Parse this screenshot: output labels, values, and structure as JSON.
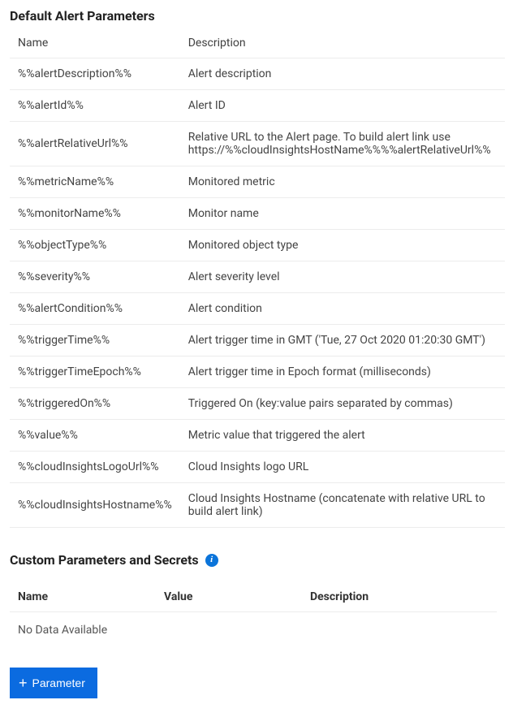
{
  "defaultParams": {
    "title": "Default Alert Parameters",
    "headers": {
      "name": "Name",
      "description": "Description"
    },
    "rows": [
      {
        "name": "%%alertDescription%%",
        "desc": "Alert description"
      },
      {
        "name": "%%alertId%%",
        "desc": "Alert ID"
      },
      {
        "name": "%%alertRelativeUrl%%",
        "desc": "Relative URL to the Alert page. To build alert link use https://%%cloudInsightsHostName%%%%alertRelativeUrl%%"
      },
      {
        "name": "%%metricName%%",
        "desc": "Monitored metric"
      },
      {
        "name": "%%monitorName%%",
        "desc": "Monitor name"
      },
      {
        "name": "%%objectType%%",
        "desc": "Monitored object type"
      },
      {
        "name": "%%severity%%",
        "desc": "Alert severity level"
      },
      {
        "name": "%%alertCondition%%",
        "desc": "Alert condition"
      },
      {
        "name": "%%triggerTime%%",
        "desc": "Alert trigger time in GMT ('Tue, 27 Oct 2020 01:20:30 GMT')"
      },
      {
        "name": "%%triggerTimeEpoch%%",
        "desc": "Alert trigger time in Epoch format (milliseconds)"
      },
      {
        "name": "%%triggeredOn%%",
        "desc": "Triggered On (key:value pairs separated by commas)"
      },
      {
        "name": "%%value%%",
        "desc": "Metric value that triggered the alert"
      },
      {
        "name": "%%cloudInsightsLogoUrl%%",
        "desc": "Cloud Insights logo URL"
      },
      {
        "name": "%%cloudInsightsHostname%%",
        "desc": "Cloud Insights Hostname (concatenate with relative URL to build alert link)"
      }
    ]
  },
  "customParams": {
    "title": "Custom Parameters and Secrets",
    "headers": {
      "name": "Name",
      "value": "Value",
      "description": "Description"
    },
    "empty": "No Data Available",
    "button": "Parameter"
  }
}
